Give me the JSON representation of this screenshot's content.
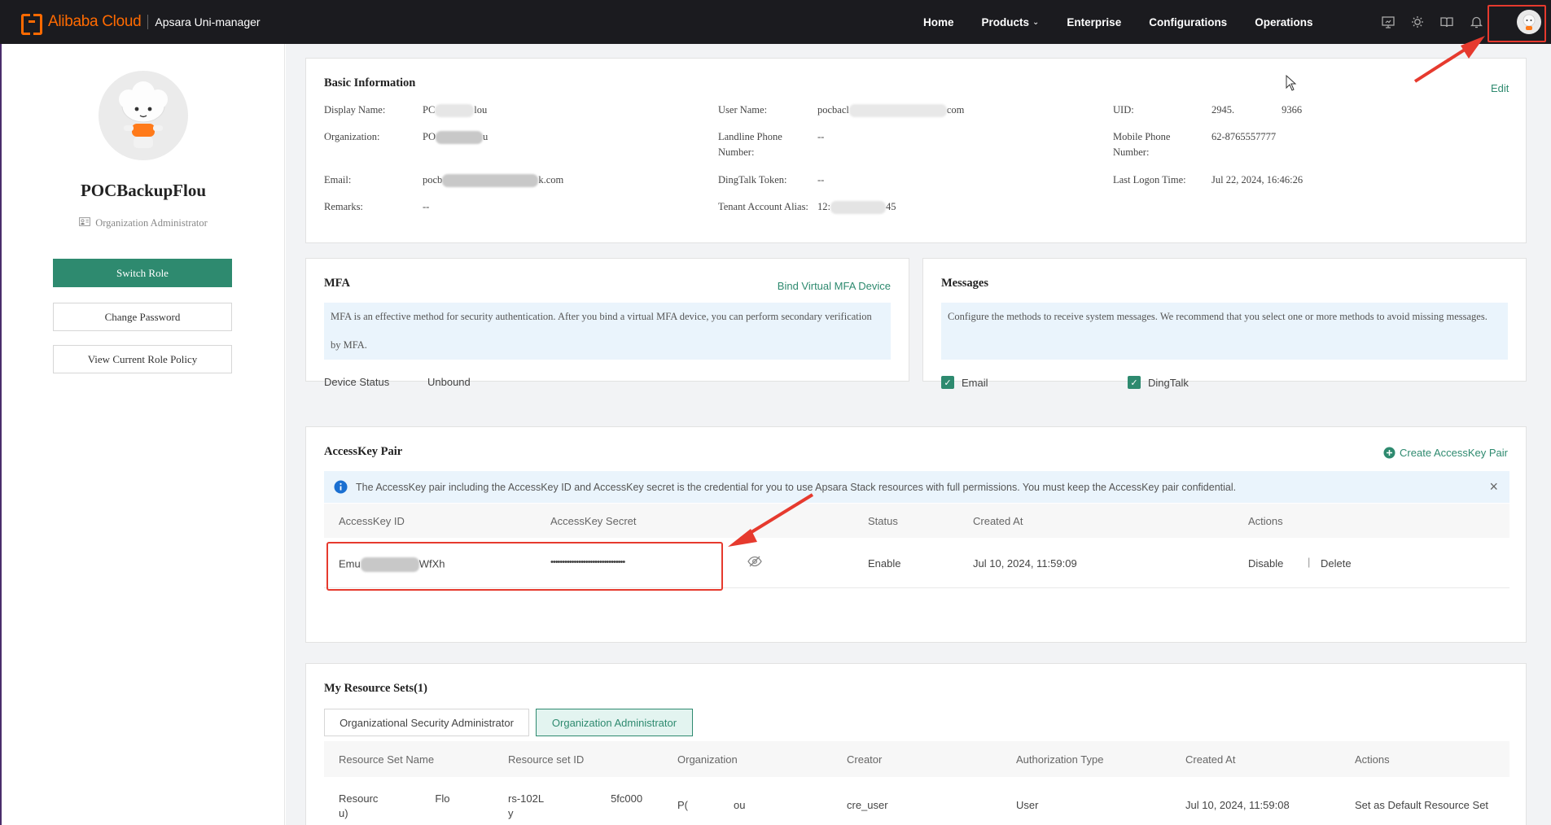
{
  "header": {
    "brand": "Alibaba Cloud",
    "product": "Apsara Uni-manager",
    "nav": [
      "Home",
      "Products",
      "Enterprise",
      "Configurations",
      "Operations"
    ]
  },
  "sidebar": {
    "user_name": "POCBackupFlou",
    "role": "Organization Administrator",
    "switch_role": "Switch Role",
    "change_password": "Change Password",
    "view_policy": "View Current Role Policy"
  },
  "basic": {
    "title": "Basic Information",
    "edit": "Edit",
    "display_name_label": "Display Name:",
    "display_name_prefix": "PC",
    "display_name_suffix": "lou",
    "organization_label": "Organization:",
    "organization_prefix": "PO",
    "organization_suffix": "u",
    "email_label": "Email:",
    "email_prefix": "pocb",
    "email_suffix": "k.com",
    "remarks_label": "Remarks:",
    "remarks_value": "--",
    "user_name_label": "User Name:",
    "user_name_prefix": "pocbacl",
    "user_name_suffix": "com",
    "landline_label": "Landline Phone Number:",
    "landline_value": "--",
    "dingtalk_label": "DingTalk Token:",
    "dingtalk_value": "--",
    "tenant_label": "Tenant Account Alias:",
    "tenant_prefix": "12:",
    "tenant_suffix": "45",
    "uid_label": "UID:",
    "uid_prefix": "2945.",
    "uid_suffix": "9366",
    "mobile_label": "Mobile Phone Number:",
    "mobile_value": "62-8765557777",
    "last_logon_label": "Last Logon Time:",
    "last_logon_value": "Jul 22, 2024, 16:46:26"
  },
  "mfa": {
    "title": "MFA",
    "bind": "Bind Virtual MFA Device",
    "notice": "MFA is an effective method for security authentication. After you bind a virtual MFA device, you can perform secondary verification by MFA.",
    "device_status_label": "Device Status",
    "device_status_value": "Unbound"
  },
  "messages": {
    "title": "Messages",
    "notice": "Configure the methods to receive system messages. We recommend that you select one or more methods to avoid missing messages.",
    "email": "Email",
    "dingtalk": "DingTalk"
  },
  "accesskey": {
    "title": "AccessKey Pair",
    "create": "Create AccessKey Pair",
    "notice": "The AccessKey pair including the AccessKey ID and AccessKey secret is the credential for you to use Apsara Stack resources with full permissions. You must keep the AccessKey pair confidential.",
    "columns": [
      "AccessKey ID",
      "AccessKey Secret",
      "Status",
      "Created At",
      "Actions"
    ],
    "row": {
      "id_prefix": "Emu",
      "id_suffix": "WfXh",
      "secret": "••••••••••••••••••••••••••••••••",
      "status": "Enable",
      "created": "Jul 10, 2024, 11:59:09",
      "disable": "Disable",
      "delete": "Delete"
    }
  },
  "resources": {
    "title": "My Resource Sets(1)",
    "tabs": [
      "Organizational Security Administrator",
      "Organization Administrator"
    ],
    "columns": [
      "Resource Set Name",
      "Resource set ID",
      "Organization",
      "Creator",
      "Authorization Type",
      "Created At",
      "Actions"
    ],
    "row": {
      "name_prefix": "Resourc",
      "name_mid": "Flo",
      "name_line2": "u)",
      "id_prefix": "rs-102L",
      "id_suffix": "5fc000",
      "id_line2": "y",
      "org_prefix": "P(",
      "org_suffix": "ou",
      "creator": "cre_user",
      "auth_type": "User",
      "created": "Jul 10, 2024, 11:59:08",
      "action": "Set as Default Resource Set"
    }
  },
  "colors": {
    "accent": "#2e8a6f",
    "brand": "#ff6a00",
    "annotation": "#e63a2e"
  }
}
